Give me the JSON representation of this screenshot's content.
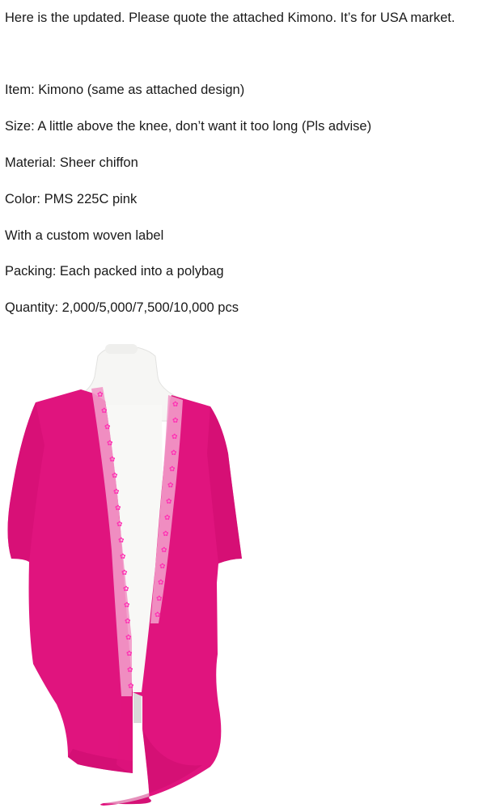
{
  "message": {
    "intro": "Here is the updated. Please quote the attached Kimono. It’s for USA market.",
    "item": "Item: Kimono (same as attached design)",
    "size": "Size: A little above the knee, don’t want it too long (Pls advise)",
    "material": "Material: Sheer chiffon",
    "color": "Color: PMS 225C pink",
    "label": "With a custom woven label",
    "packing": "Packing: Each packed into a polybag",
    "quantity": "Quantity: 2,000/5,000/7,500/10,000 pcs"
  },
  "attachment": {
    "kimono_color": "#e0147e",
    "trim_color": "#f29ac9",
    "flower_color": "#ff2fb3",
    "mannequin_color": "#f6f6f4"
  }
}
